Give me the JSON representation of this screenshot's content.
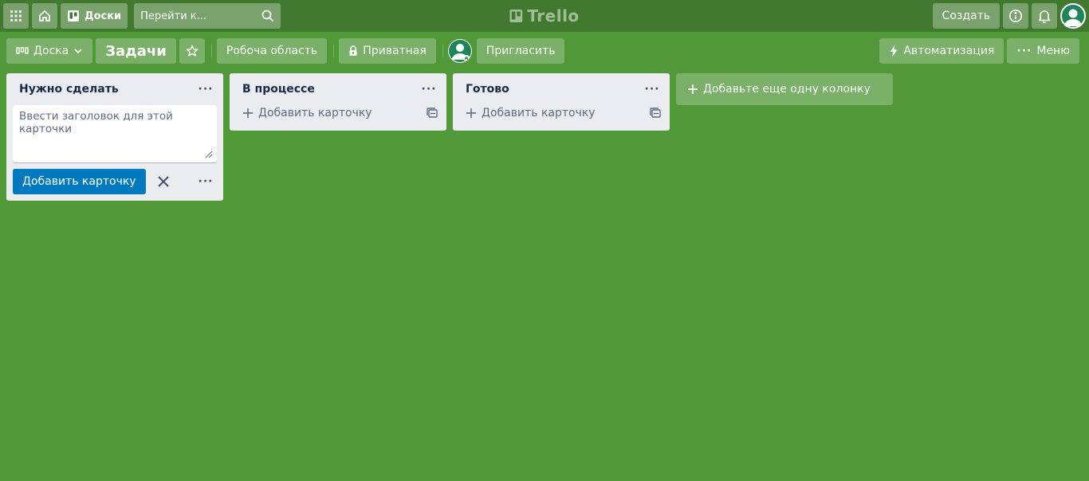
{
  "topbar": {
    "boards_label": "Доски",
    "search_placeholder": "Перейти к...",
    "logo_text": "Trello",
    "create_label": "Создать"
  },
  "boardbar": {
    "view_label": "Доска",
    "board_title": "Задачи",
    "workspace_label": "Робоча область",
    "visibility_label": "Приватная",
    "invite_label": "Пригласить",
    "automation_label": "Автоматизация",
    "menu_label": "Меню"
  },
  "lists": [
    {
      "title": "Нужно сделать",
      "composer_placeholder": "Ввести заголовок для этой карточки",
      "add_button_label": "Добавить карточку"
    },
    {
      "title": "В процессе",
      "add_card_label": "Добавить карточку"
    },
    {
      "title": "Готово",
      "add_card_label": "Добавить карточку"
    }
  ],
  "add_list_label": "Добавьте еще одну колонку",
  "colors": {
    "background": "#519839",
    "topbar": "#417a2e",
    "list_bg": "#ebecf0",
    "primary_button": "#0079bf"
  }
}
